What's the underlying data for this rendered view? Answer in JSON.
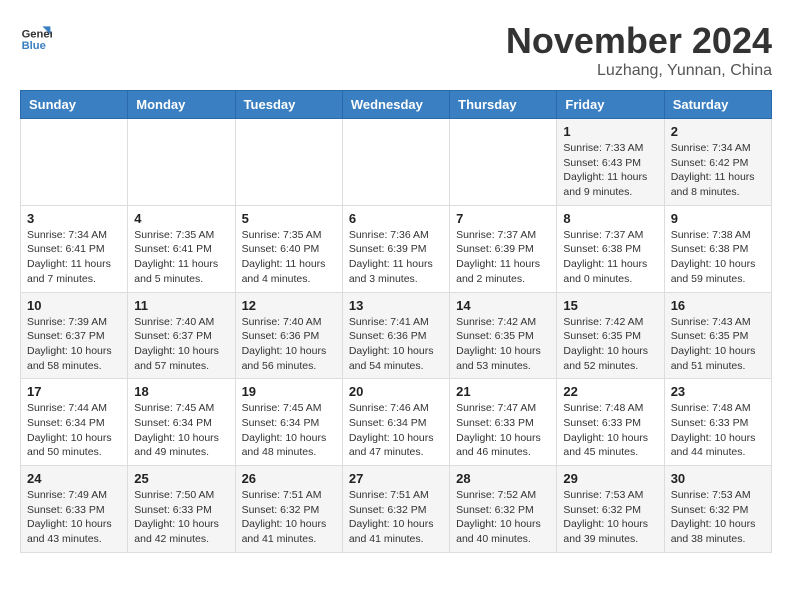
{
  "header": {
    "logo_line1": "General",
    "logo_line2": "Blue",
    "month_title": "November 2024",
    "subtitle": "Luzhang, Yunnan, China"
  },
  "weekdays": [
    "Sunday",
    "Monday",
    "Tuesday",
    "Wednesday",
    "Thursday",
    "Friday",
    "Saturday"
  ],
  "weeks": [
    [
      {
        "day": "",
        "info": ""
      },
      {
        "day": "",
        "info": ""
      },
      {
        "day": "",
        "info": ""
      },
      {
        "day": "",
        "info": ""
      },
      {
        "day": "",
        "info": ""
      },
      {
        "day": "1",
        "info": "Sunrise: 7:33 AM\nSunset: 6:43 PM\nDaylight: 11 hours and 9 minutes."
      },
      {
        "day": "2",
        "info": "Sunrise: 7:34 AM\nSunset: 6:42 PM\nDaylight: 11 hours and 8 minutes."
      }
    ],
    [
      {
        "day": "3",
        "info": "Sunrise: 7:34 AM\nSunset: 6:41 PM\nDaylight: 11 hours and 7 minutes."
      },
      {
        "day": "4",
        "info": "Sunrise: 7:35 AM\nSunset: 6:41 PM\nDaylight: 11 hours and 5 minutes."
      },
      {
        "day": "5",
        "info": "Sunrise: 7:35 AM\nSunset: 6:40 PM\nDaylight: 11 hours and 4 minutes."
      },
      {
        "day": "6",
        "info": "Sunrise: 7:36 AM\nSunset: 6:39 PM\nDaylight: 11 hours and 3 minutes."
      },
      {
        "day": "7",
        "info": "Sunrise: 7:37 AM\nSunset: 6:39 PM\nDaylight: 11 hours and 2 minutes."
      },
      {
        "day": "8",
        "info": "Sunrise: 7:37 AM\nSunset: 6:38 PM\nDaylight: 11 hours and 0 minutes."
      },
      {
        "day": "9",
        "info": "Sunrise: 7:38 AM\nSunset: 6:38 PM\nDaylight: 10 hours and 59 minutes."
      }
    ],
    [
      {
        "day": "10",
        "info": "Sunrise: 7:39 AM\nSunset: 6:37 PM\nDaylight: 10 hours and 58 minutes."
      },
      {
        "day": "11",
        "info": "Sunrise: 7:40 AM\nSunset: 6:37 PM\nDaylight: 10 hours and 57 minutes."
      },
      {
        "day": "12",
        "info": "Sunrise: 7:40 AM\nSunset: 6:36 PM\nDaylight: 10 hours and 56 minutes."
      },
      {
        "day": "13",
        "info": "Sunrise: 7:41 AM\nSunset: 6:36 PM\nDaylight: 10 hours and 54 minutes."
      },
      {
        "day": "14",
        "info": "Sunrise: 7:42 AM\nSunset: 6:35 PM\nDaylight: 10 hours and 53 minutes."
      },
      {
        "day": "15",
        "info": "Sunrise: 7:42 AM\nSunset: 6:35 PM\nDaylight: 10 hours and 52 minutes."
      },
      {
        "day": "16",
        "info": "Sunrise: 7:43 AM\nSunset: 6:35 PM\nDaylight: 10 hours and 51 minutes."
      }
    ],
    [
      {
        "day": "17",
        "info": "Sunrise: 7:44 AM\nSunset: 6:34 PM\nDaylight: 10 hours and 50 minutes."
      },
      {
        "day": "18",
        "info": "Sunrise: 7:45 AM\nSunset: 6:34 PM\nDaylight: 10 hours and 49 minutes."
      },
      {
        "day": "19",
        "info": "Sunrise: 7:45 AM\nSunset: 6:34 PM\nDaylight: 10 hours and 48 minutes."
      },
      {
        "day": "20",
        "info": "Sunrise: 7:46 AM\nSunset: 6:34 PM\nDaylight: 10 hours and 47 minutes."
      },
      {
        "day": "21",
        "info": "Sunrise: 7:47 AM\nSunset: 6:33 PM\nDaylight: 10 hours and 46 minutes."
      },
      {
        "day": "22",
        "info": "Sunrise: 7:48 AM\nSunset: 6:33 PM\nDaylight: 10 hours and 45 minutes."
      },
      {
        "day": "23",
        "info": "Sunrise: 7:48 AM\nSunset: 6:33 PM\nDaylight: 10 hours and 44 minutes."
      }
    ],
    [
      {
        "day": "24",
        "info": "Sunrise: 7:49 AM\nSunset: 6:33 PM\nDaylight: 10 hours and 43 minutes."
      },
      {
        "day": "25",
        "info": "Sunrise: 7:50 AM\nSunset: 6:33 PM\nDaylight: 10 hours and 42 minutes."
      },
      {
        "day": "26",
        "info": "Sunrise: 7:51 AM\nSunset: 6:32 PM\nDaylight: 10 hours and 41 minutes."
      },
      {
        "day": "27",
        "info": "Sunrise: 7:51 AM\nSunset: 6:32 PM\nDaylight: 10 hours and 41 minutes."
      },
      {
        "day": "28",
        "info": "Sunrise: 7:52 AM\nSunset: 6:32 PM\nDaylight: 10 hours and 40 minutes."
      },
      {
        "day": "29",
        "info": "Sunrise: 7:53 AM\nSunset: 6:32 PM\nDaylight: 10 hours and 39 minutes."
      },
      {
        "day": "30",
        "info": "Sunrise: 7:53 AM\nSunset: 6:32 PM\nDaylight: 10 hours and 38 minutes."
      }
    ]
  ]
}
